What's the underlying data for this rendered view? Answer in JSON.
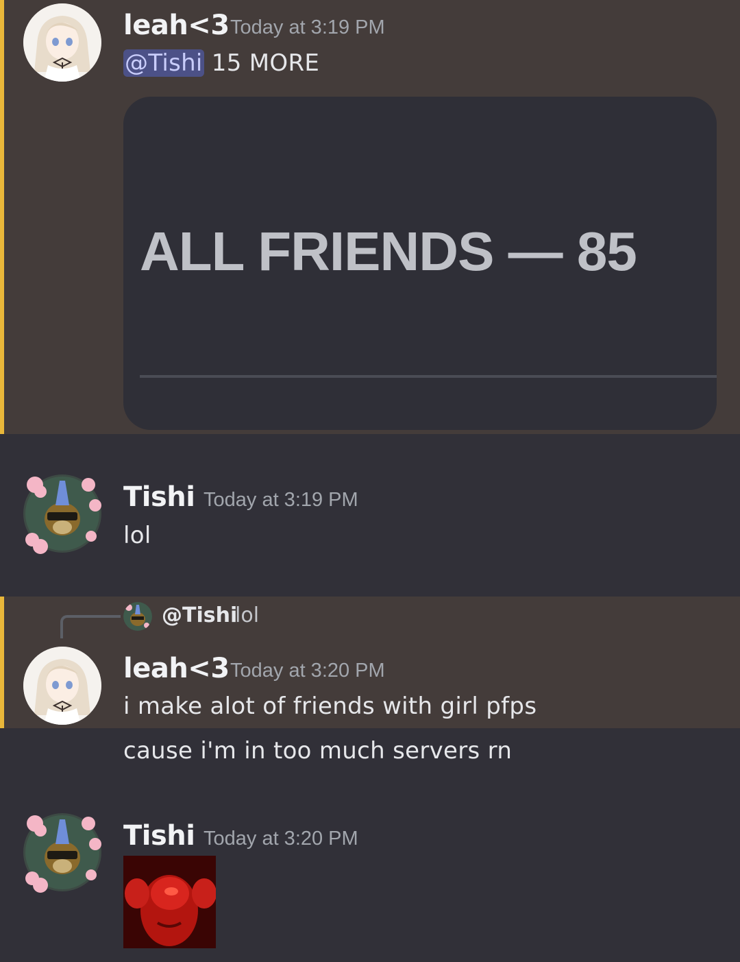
{
  "messages": [
    {
      "author": "leah<3",
      "timestamp": "Today at 3:19 PM",
      "mention": "@Tishi",
      "text": " 15 MORE",
      "embed": {
        "title": "ALL FRIENDS — 85"
      }
    },
    {
      "author": "Tishi",
      "timestamp": "Today at 3:19 PM",
      "text": "lol"
    },
    {
      "reply": {
        "author": "@Tishi",
        "text": "lol"
      },
      "author": "leah<3",
      "timestamp": "Today at 3:20 PM",
      "text": "i make alot of friends with girl pfps",
      "followup": "cause i'm in too much servers rn"
    },
    {
      "author": "Tishi",
      "timestamp": "Today at 3:20 PM",
      "attachment": "image"
    }
  ],
  "colors": {
    "background": "#313038",
    "highlight": "#443c3a",
    "highlight_bar": "#e9b73a",
    "mention_bg": "#4c5187"
  }
}
